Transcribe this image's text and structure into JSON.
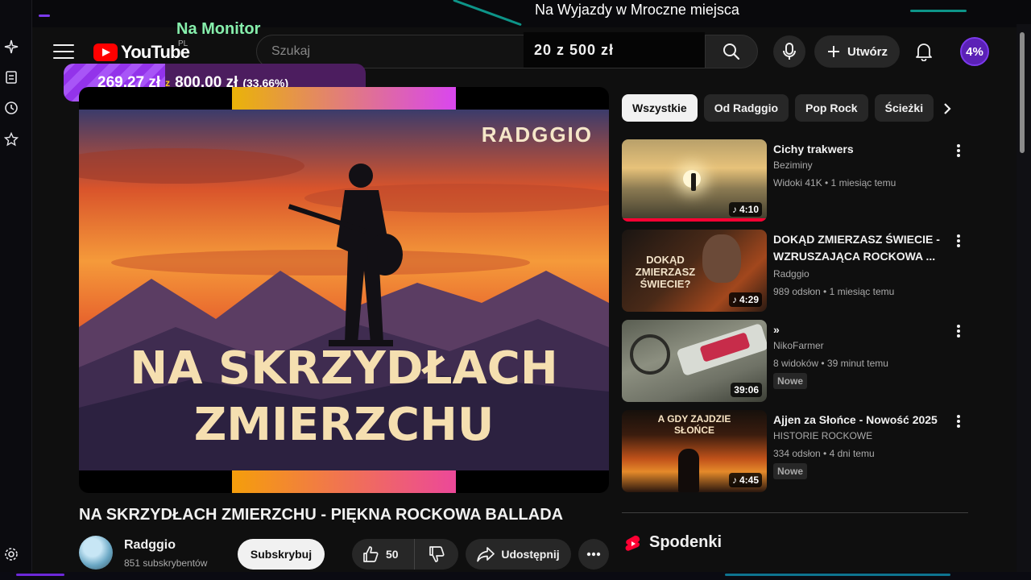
{
  "overlay": {
    "goal_title": "Na Wyjazdy w Mroczne miejsca",
    "goal_amount": "20 z 500 zł",
    "monitor_label": "Na Monitor",
    "donation": {
      "current": "269,27 zł",
      "separator": "z",
      "target": "800,00 zł",
      "percent": "(33.66%)",
      "progress": 0.3366
    },
    "side_icons": [
      "sparkle-icon",
      "document-icon",
      "clock-icon",
      "star-icon",
      "settings-icon"
    ],
    "accent": "#7c3aed"
  },
  "header": {
    "logo_text": "YouTube",
    "region": "PL",
    "search_placeholder": "Szukaj",
    "create_label": "Utwórz",
    "avatar_text": "4%"
  },
  "video": {
    "thumbnail_brand": "RADGGIO",
    "thumbnail_line1": "NA SKRZYDŁACH",
    "thumbnail_line2": "ZMIERZCHU",
    "title": "NA SKRZYDŁACH ZMIERZCHU - PIĘKNA ROCKOWA BALLADA",
    "channel": "Radggio",
    "subscribers": "851 subskrybentów",
    "subscribe_label": "Subskrybuj",
    "likes": "50",
    "share_label": "Udostępnij"
  },
  "chips": [
    "Wszystkie",
    "Od Radggio",
    "Pop Rock",
    "Ścieżki"
  ],
  "recommendations": [
    {
      "title": "Cichy trakwers",
      "channel": "Beziminy",
      "meta": "Widoki 41K • 1 miesiąc temu",
      "duration": "4:10",
      "badge": "",
      "watched": true
    },
    {
      "title": "DOKĄD ZMIERZASZ ŚWIECIE - WZRUSZAJĄCA ROCKOWA ...",
      "channel": "Radggio",
      "meta": "989 odsłon • 1 miesiąc temu",
      "duration": "4:29",
      "badge": "",
      "thumb_text": "DOKĄD ZMIERZASZ ŚWIECIE?",
      "watched": false
    },
    {
      "title": "»",
      "channel": "NikoFarmer",
      "meta": "8 widoków • 39 minut temu",
      "duration": "39:06",
      "badge": "Nowe",
      "watched": false
    },
    {
      "title": "Ajjen za Słońce - Nowość 2025",
      "channel": "HISTORIE ROCKOWE",
      "meta": "334 odsłon • 4 dni temu",
      "duration": "4:45",
      "badge": "Nowe",
      "thumb_text": "A GDY ZAJDZIE SŁOŃCE",
      "watched": false
    }
  ],
  "shorts_title": "Spodenki"
}
